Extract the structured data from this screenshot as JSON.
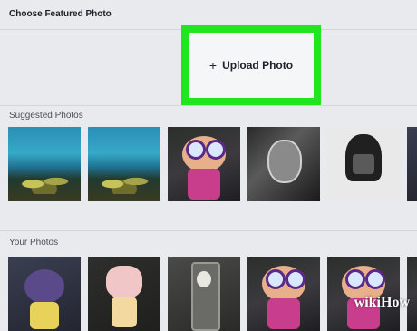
{
  "dialog": {
    "title": "Choose Featured Photo",
    "upload": {
      "plus": "+",
      "label": "Upload Photo"
    }
  },
  "sections": {
    "suggested": {
      "label": "Suggested Photos"
    },
    "yours": {
      "label": "Your Photos"
    }
  },
  "colors": {
    "highlight": "#1fe61f",
    "upload_bg": "#f5f6f7",
    "page_bg": "#e9eaed"
  },
  "watermark": "wikiHow"
}
